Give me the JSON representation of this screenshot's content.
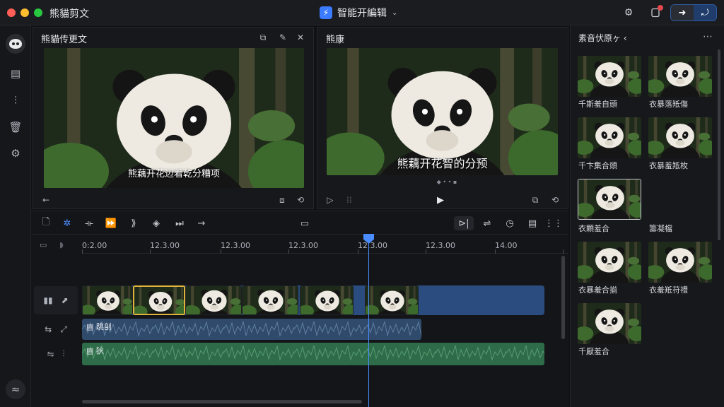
{
  "window": {
    "app_title": "熊貓剪文",
    "center_title": "智能开編辑",
    "center_logo": "⚡"
  },
  "left_panel": {
    "title": "熊貓传更文",
    "caption": "熊藕开花辺着乾分糟项"
  },
  "right_preview": {
    "title": "熊康",
    "caption": "熊藕开花智的分预"
  },
  "timeline": {
    "ticks": [
      "0:2.00",
      "12.3.00",
      "12.3.00",
      "12.3.00",
      "12.3.00",
      "12.3.00",
      "14.00"
    ],
    "audio1_label": "▤ 跳剖",
    "audio2_label": "▤ 狄"
  },
  "library": {
    "title": "素音伏原ヶ ‹",
    "items": [
      {
        "label": "千斯羞自頭"
      },
      {
        "label": "衣暴落羝傷"
      },
      {
        "label": "千卞集合頭"
      },
      {
        "label": "衣暴羞羝枚"
      },
      {
        "label": "衣顆羞合"
      },
      {
        "label": "籌凝檔"
      },
      {
        "label": "衣暴羞合揃"
      },
      {
        "label": "衣羞羝苻禮"
      },
      {
        "label": "千厭羞合"
      }
    ]
  },
  "colors": {
    "accent": "#4b8dff",
    "close": "#ff5f57",
    "minimize": "#febc2e",
    "maximize": "#28c840",
    "video_track": "#2b4c7e",
    "audio_track": "#2e6b48"
  }
}
